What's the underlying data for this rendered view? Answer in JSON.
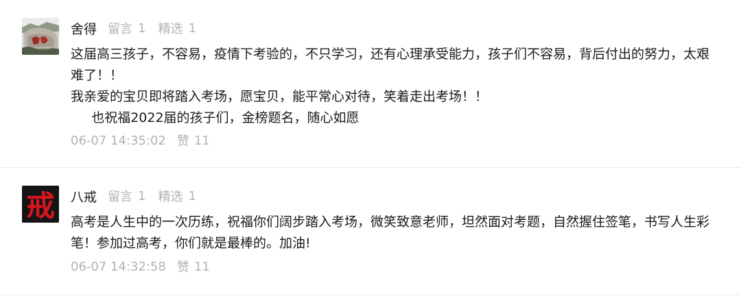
{
  "comments": [
    {
      "author": "舍得",
      "reply_label": "留言",
      "reply_count": "1",
      "featured_label": "精选",
      "featured_count": "1",
      "body_lines": [
        "这届高三孩子，不容易，疫情下考验的，不只学习，还有心理承受能力，孩子们不容易，背后付出的努力，太艰",
        "难了！！",
        "我亲爱的宝贝即将踏入考场，愿宝贝，能平常心对待，笑着走出考场！！",
        "     也祝福2022届的孩子们，金榜题名，随心如愿"
      ],
      "time": "06-07 14:35:02",
      "like_label": "赞",
      "like_count": "11"
    },
    {
      "author": "八戒",
      "reply_label": "留言",
      "reply_count": "1",
      "featured_label": "精选",
      "featured_count": "1",
      "body_lines": [
        "高考是人生中的一次历练，祝福你们阔步踏入考场，微笑致意老师，坦然面对考题，自然握住签笔，书写人生彩",
        "笔！参加过高考，你们就是最棒的。加油!"
      ],
      "avatar_glyph": "戒",
      "time": "06-07 14:32:58",
      "like_label": "赞",
      "like_count": "11"
    }
  ],
  "colors": {
    "text": "#1a1a1a",
    "meta": "#b2b2b2",
    "divider": "#e8e8e8",
    "avatar2_bg": "#1a1a1a",
    "avatar2_glyph": "#d8141c"
  }
}
